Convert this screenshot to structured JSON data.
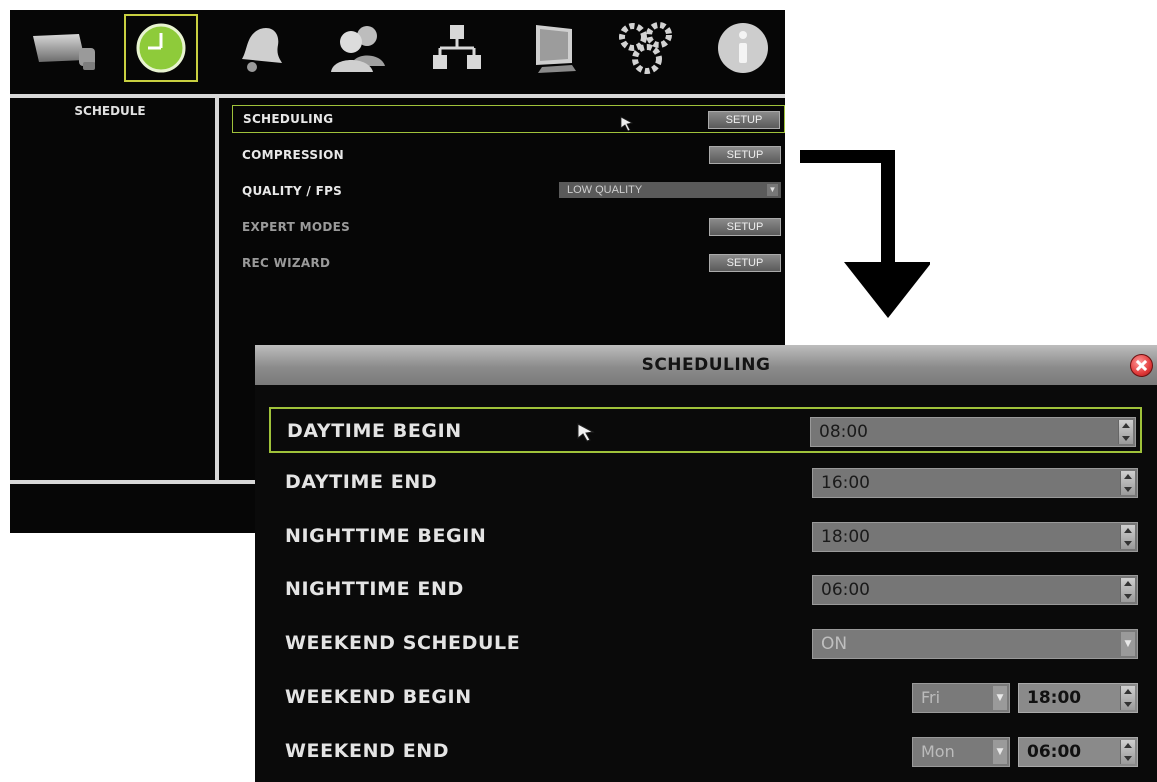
{
  "menu": {
    "top_icons": [
      {
        "name": "camera-icon",
        "active": false
      },
      {
        "name": "clock-icon",
        "active": true
      },
      {
        "name": "bell-icon",
        "active": false
      },
      {
        "name": "users-icon",
        "active": false
      },
      {
        "name": "network-icon",
        "active": false
      },
      {
        "name": "monitor-icon",
        "active": false
      },
      {
        "name": "gears-icon",
        "active": false
      },
      {
        "name": "info-icon",
        "active": false
      }
    ],
    "section_label": "SCHEDULE",
    "rows": [
      {
        "label": "SCHEDULING",
        "control": "button",
        "button_label": "SETUP",
        "selected": true,
        "dim": false
      },
      {
        "label": "COMPRESSION",
        "control": "button",
        "button_label": "SETUP",
        "selected": false,
        "dim": false
      },
      {
        "label": "QUALITY / FPS",
        "control": "select",
        "value": "LOW QUALITY",
        "selected": false,
        "dim": false
      },
      {
        "label": "EXPERT MODES",
        "control": "button",
        "button_label": "SETUP",
        "selected": false,
        "dim": true
      },
      {
        "label": "REC WIZARD",
        "control": "button",
        "button_label": "SETUP",
        "selected": false,
        "dim": true
      }
    ]
  },
  "dialog": {
    "title": "SCHEDULING",
    "rows": [
      {
        "label": "DAYTIME BEGIN",
        "value": "08:00",
        "selected": true
      },
      {
        "label": "DAYTIME END",
        "value": "16:00",
        "selected": false
      },
      {
        "label": "NIGHTTIME BEGIN",
        "value": "18:00",
        "selected": false
      },
      {
        "label": "NIGHTTIME END",
        "value": "06:00",
        "selected": false
      }
    ],
    "weekend_schedule": {
      "label": "WEEKEND SCHEDULE",
      "value": "ON"
    },
    "weekend_begin": {
      "label": "WEEKEND BEGIN",
      "day": "Fri",
      "time": "18:00"
    },
    "weekend_end": {
      "label": "WEEKEND END",
      "day": "Mon",
      "time": "06:00"
    }
  },
  "colors": {
    "accent_green": "#9fc23a",
    "clock_icon_green": "#8ecb3a",
    "background": "#060606"
  }
}
